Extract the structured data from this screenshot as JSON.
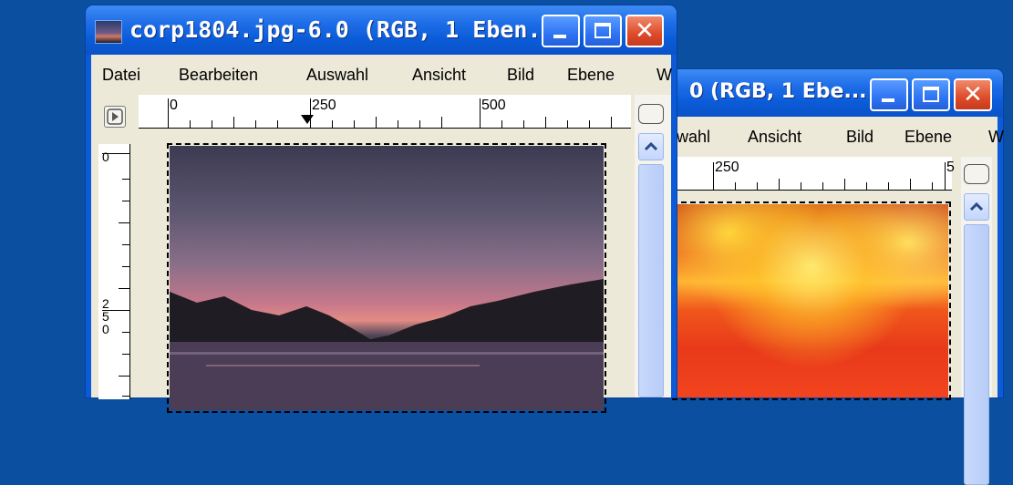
{
  "window_back": {
    "title": "0 (RGB, 1 Ebe...",
    "menu": [
      "wahl",
      "Ansicht",
      "Bild",
      "Ebene",
      "W"
    ],
    "ruler_labels": [
      "250",
      "5"
    ]
  },
  "window_front": {
    "title": "corp1804.jpg-6.0 (RGB, 1 Eben...",
    "menu": [
      "Datei",
      "Bearbeiten",
      "Auswahl",
      "Ansicht",
      "Bild",
      "Ebene",
      "W"
    ],
    "ruler_h_labels": [
      "0",
      "250",
      "500"
    ],
    "ruler_v_labels": [
      "0",
      "2\n5\n0"
    ]
  },
  "icons": {
    "image_icon": "image-thumbnail-icon",
    "minimize": "minimize-icon",
    "maximize": "maximize-icon",
    "close": "close-icon",
    "nav": "navigate-icon",
    "scroll_up": "chevron-up-icon",
    "zoom_corner": "zoom-corner-icon",
    "close_glyph": "✕"
  },
  "colors": {
    "desktop": "#0a4fa0",
    "titlebar": "#0b5bd8",
    "close_button": "#de4b2a",
    "window_body": "#ece9d8"
  }
}
